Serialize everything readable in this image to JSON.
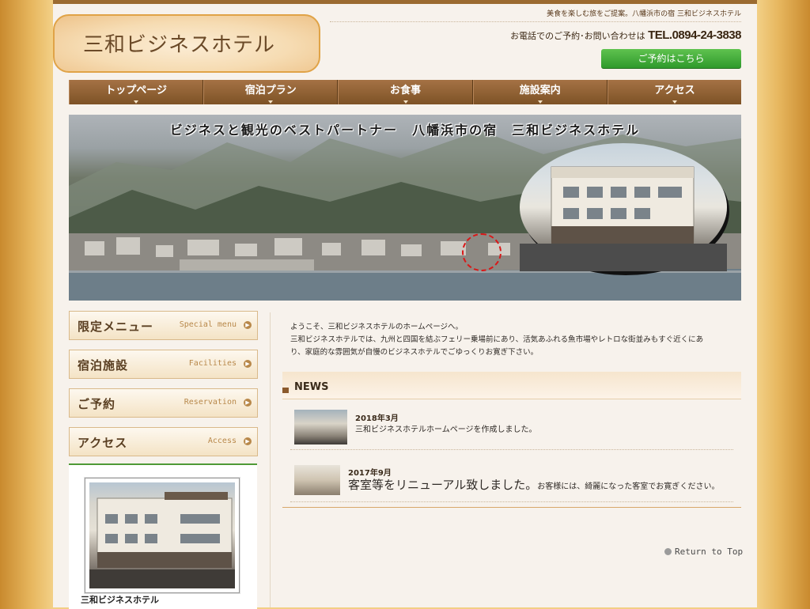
{
  "header": {
    "logo_text": "三和ビジネスホテル",
    "tagline": "美食を楽しむ旅をご提案。八幡浜市の宿 三和ビジネスホテル",
    "contact_label": "お電話でのご予約･お問い合わせは",
    "phone": "TEL.0894-24-3838",
    "reserve_button": "ご予約はこちら"
  },
  "nav": {
    "items": [
      {
        "label": "トップページ"
      },
      {
        "label": "宿泊プラン"
      },
      {
        "label": "お食事"
      },
      {
        "label": "施設案内"
      },
      {
        "label": "アクセス"
      }
    ]
  },
  "hero": {
    "title": "ビジネスと観光のベストパートナー　八幡浜市の宿　三和ビジネスホテル"
  },
  "sidebar": {
    "items": [
      {
        "jp": "限定メニュー",
        "en": "Special menu"
      },
      {
        "jp": "宿泊施設",
        "en": "Facilities"
      },
      {
        "jp": "ご予約",
        "en": "Reservation"
      },
      {
        "jp": "アクセス",
        "en": "Access"
      }
    ],
    "photo_caption": "三和ビジネスホテル"
  },
  "main": {
    "welcome_lines": [
      "ようこそ、三和ビジネスホテルのホームページへ。",
      "三和ビジネスホテルでは、九州と四国を結ぶフェリー乗場前にあり、活気あふれる魚市場やレトロな街並みもすぐ近くにあ",
      "り、家庭的な雰囲気が自慢のビジネスホテルでごゆっくりお寛ぎ下さい。"
    ],
    "news_title": "NEWS",
    "news": [
      {
        "date": "2018年3月",
        "text": "三和ビジネスホテルホームページを作成しました。"
      },
      {
        "date": "2017年9月",
        "headline": "客室等をリニューアル致しました。",
        "text": "お客様には、綺麗になった客室でお寛ぎください。"
      }
    ],
    "return_top": "Return to Top"
  },
  "colors": {
    "nav_brown": "#8e5f30",
    "reserve_green": "#2f9a2c",
    "accent_gold": "#e0a347"
  }
}
